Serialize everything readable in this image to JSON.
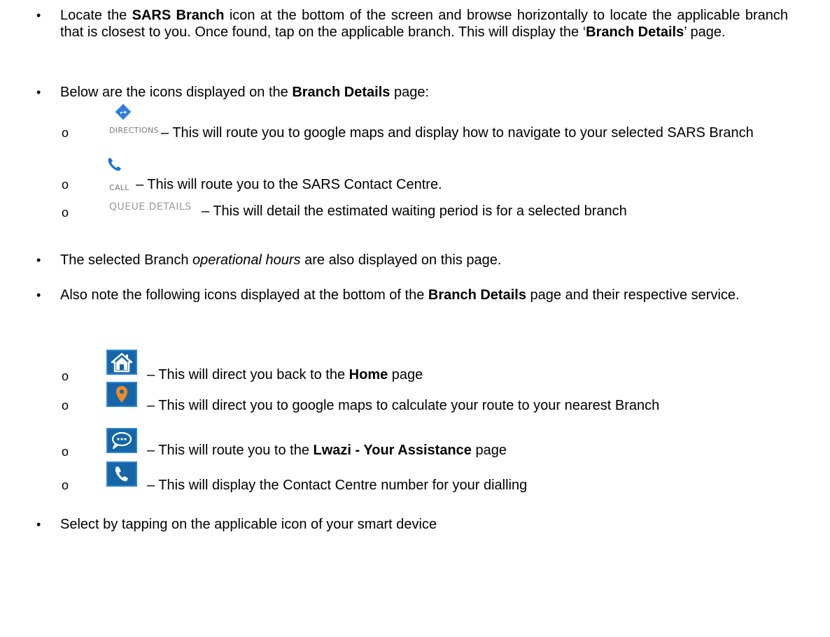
{
  "bullets": {
    "b1": {
      "p1": "Locate the ",
      "b1": "SARS Branch",
      "p2": " icon at the bottom of the screen and browse horizontally to locate the applicable branch that is closest to you. Once found, tap on the applicable branch. This will display the ‘",
      "b2": "Branch Details",
      "p3": "’ page."
    },
    "b2": {
      "p1": "Below are the icons displayed on the ",
      "b1": "Branch Details",
      "p2": " page:"
    },
    "b3": {
      "p1": "The selected Branch ",
      "i1": "operational hours",
      "p2": " are also displayed on this page."
    },
    "b4": {
      "p1": "Also note the following icons displayed at the bottom of the ",
      "b1": "Branch Details",
      "p2": " page and their respective service."
    },
    "b5": {
      "p1": "Select by tapping on the applicable icon of your smart device"
    }
  },
  "page_icons": [
    {
      "icon": "directions-icon",
      "label": "DIRECTIONS",
      "desc": "– This will route you to google maps and display how to navigate to your selected SARS Branch"
    },
    {
      "icon": "phone-icon",
      "label": "CALL",
      "desc": "– This will route you to the SARS Contact Centre."
    },
    {
      "icon": "queue-icon",
      "label": "QUEUE DETAILS",
      "desc": "–  This will detail the estimated waiting period is for a selected branch"
    }
  ],
  "bottom_icons": [
    {
      "icon": "home-icon",
      "p1": "– This will direct you back to the ",
      "b1": "Home",
      "p2": " page"
    },
    {
      "icon": "map-pin-icon",
      "p1": "– This will direct you to google maps to calculate your route to your nearest Branch"
    },
    {
      "icon": "chat-icon",
      "p1": "– This will route you to the ",
      "b1": "Lwazi - Your Assistance",
      "p2": " page"
    },
    {
      "icon": "contact-phone-icon",
      "p1": "– This will display the Contact Centre number for your dialling"
    }
  ],
  "markers": {
    "bullet": "•",
    "sub": "o"
  },
  "colors": {
    "nav_icon_bg": "#1565a8",
    "map_pin": "#f08a24",
    "directions": "#2f7de1"
  }
}
